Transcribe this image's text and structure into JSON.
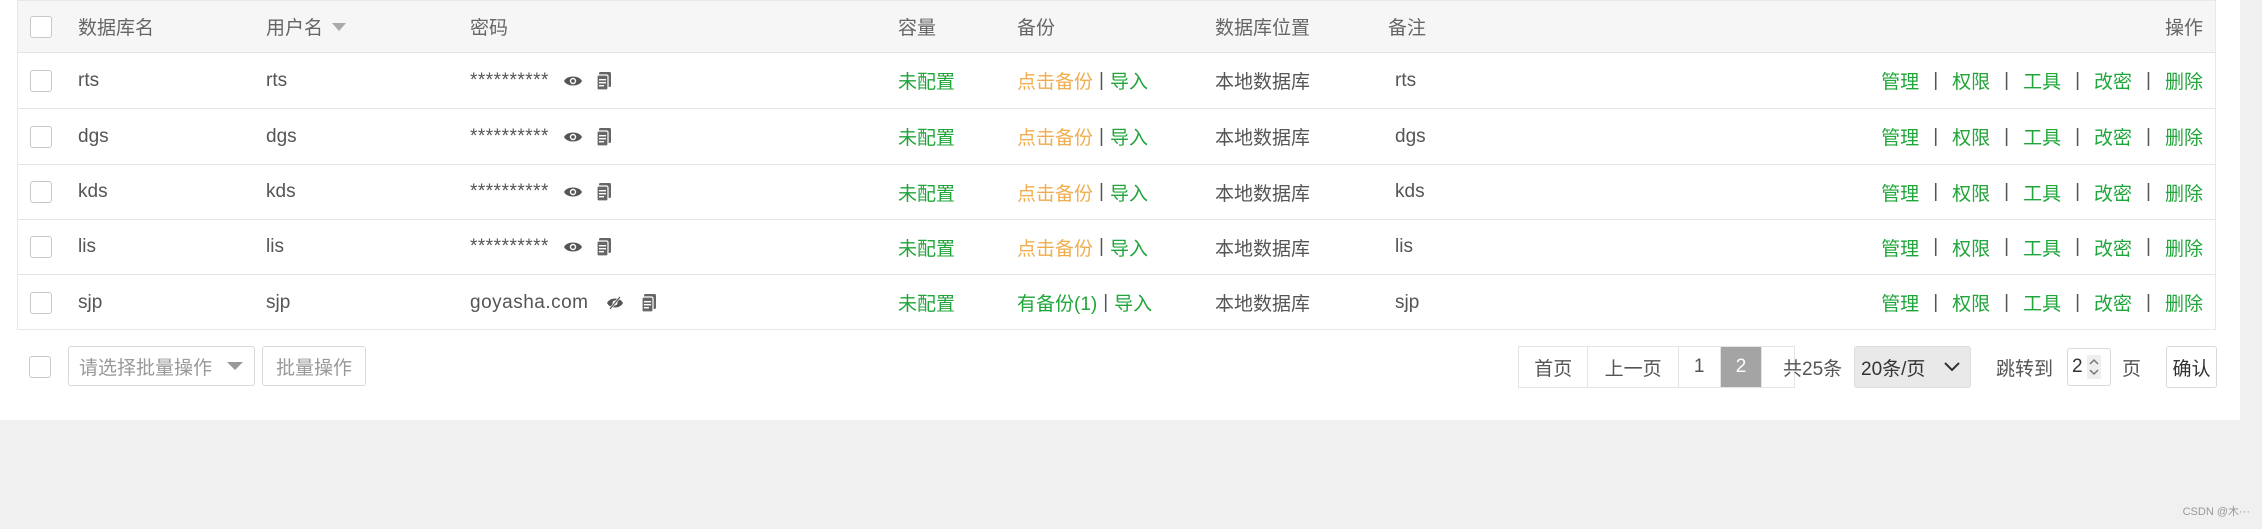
{
  "columns": {
    "name": "数据库名",
    "user": "用户名",
    "password": "密码",
    "capacity": "容量",
    "backup": "备份",
    "location": "数据库位置",
    "remark": "备注",
    "actions": "操作"
  },
  "rows": [
    {
      "name": "rts",
      "user": "rts",
      "password": "**********",
      "capacity": "未配置",
      "backup": "点击备份",
      "import": "导入",
      "location": "本地数据库",
      "remark": "rts"
    },
    {
      "name": "dgs",
      "user": "dgs",
      "password": "**********",
      "capacity": "未配置",
      "backup": "点击备份",
      "import": "导入",
      "location": "本地数据库",
      "remark": "dgs"
    },
    {
      "name": "kds",
      "user": "kds",
      "password": "**********",
      "capacity": "未配置",
      "backup": "点击备份",
      "import": "导入",
      "location": "本地数据库",
      "remark": "kds"
    },
    {
      "name": "lis",
      "user": "lis",
      "password": "**********",
      "capacity": "未配置",
      "backup": "点击备份",
      "import": "导入",
      "location": "本地数据库",
      "remark": "lis"
    },
    {
      "name": "sjp",
      "user": "sjp",
      "password": "goyasha.com",
      "capacity": "未配置",
      "backup": "有备份(1)",
      "import": "导入",
      "location": "本地数据库",
      "remark": "sjp"
    }
  ],
  "actions": {
    "manage": "管理",
    "permission": "权限",
    "tools": "工具",
    "change_password": "改密",
    "delete": "删除",
    "separator": "|"
  },
  "footer": {
    "batch_select_placeholder": "请选择批量操作",
    "batch_button": "批量操作"
  },
  "pagination": {
    "first": "首页",
    "prev": "上一页",
    "page1": "1",
    "page2": "2",
    "total": "共25条",
    "per_page": "20条/页",
    "jump_label": "跳转到",
    "jump_value": "2",
    "page_unit": "页",
    "confirm": "确认"
  },
  "watermark": "CSDN @木···",
  "colors": {
    "green": "#20a53a",
    "orange": "#f0ad4e",
    "active_page": "#a4a4a4"
  },
  "icons": {
    "show": "eye-icon",
    "hide": "eye-slash-icon",
    "copy": "copy-icon",
    "sort": "sort-down-icon",
    "dropdown": "chevron-down-icon"
  }
}
